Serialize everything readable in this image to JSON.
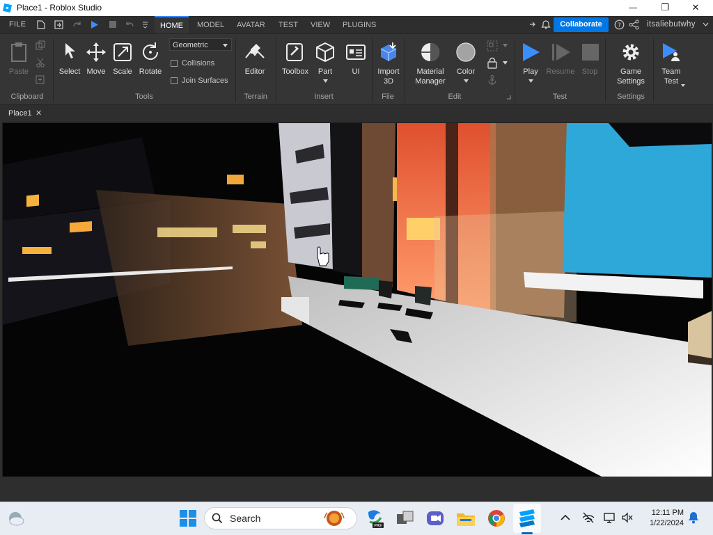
{
  "window": {
    "title": "Place1 - Roblox Studio",
    "controls": {
      "minimize": "—",
      "maximize": "❐",
      "close": "✕"
    }
  },
  "menubar": {
    "file": "FILE",
    "tabs": [
      {
        "label": "HOME",
        "active": true
      },
      {
        "label": "MODEL"
      },
      {
        "label": "AVATAR"
      },
      {
        "label": "TEST"
      },
      {
        "label": "VIEW"
      },
      {
        "label": "PLUGINS"
      }
    ],
    "collaborate": "Collaborate",
    "username": "itsaliebutwhy"
  },
  "ribbon": {
    "clipboard": {
      "paste": "Paste",
      "group": "Clipboard"
    },
    "tools": {
      "select": "Select",
      "move": "Move",
      "scale": "Scale",
      "rotate": "Rotate",
      "mode": "Geometric",
      "collisions": "Collisions",
      "join_surfaces": "Join Surfaces",
      "group": "Tools"
    },
    "terrain": {
      "editor": "Editor",
      "group": "Terrain"
    },
    "insert": {
      "toolbox": "Toolbox",
      "part": "Part",
      "ui": "UI",
      "group": "Insert"
    },
    "file": {
      "import_line1": "Import",
      "import_line2": "3D",
      "group": "File"
    },
    "edit": {
      "material_line1": "Material",
      "material_line2": "Manager",
      "color": "Color",
      "group": "Edit"
    },
    "test": {
      "play": "Play",
      "resume": "Resume",
      "stop": "Stop",
      "group": "Test"
    },
    "settings": {
      "game_line1": "Game",
      "game_line2": "Settings",
      "group": "Settings"
    },
    "team": {
      "line1": "Team",
      "line2": "Test"
    }
  },
  "doc_tabs": [
    {
      "label": "Place1",
      "close": "✕"
    }
  ],
  "taskbar": {
    "search": "Search",
    "time": "12:11 PM",
    "date": "1/22/2024"
  },
  "colors": {
    "accent": "#0077e6",
    "play": "#3a8dff",
    "active_tab_border": "#3a88ff"
  }
}
